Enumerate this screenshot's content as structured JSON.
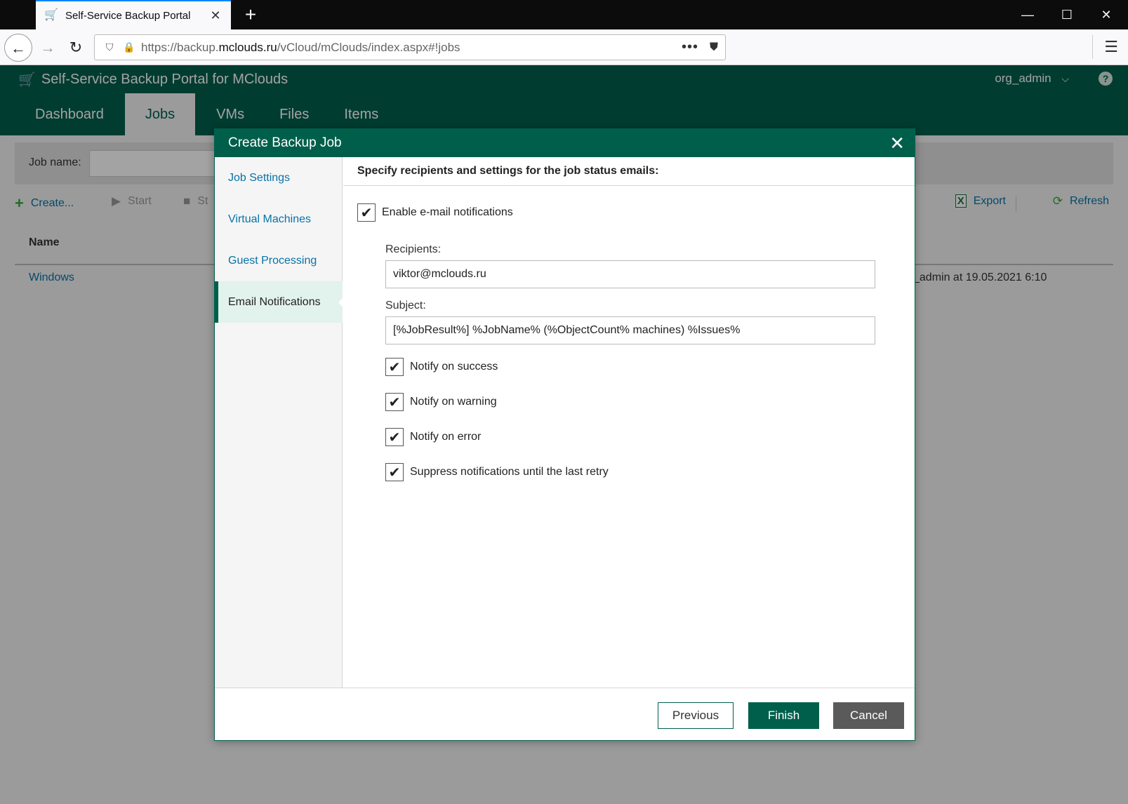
{
  "browser": {
    "tab_title": "Self-Service Backup Portal",
    "url_prefix": "https://backup.",
    "url_domain": "mclouds.ru",
    "url_path": "/vCloud/mClouds/index.aspx#!jobs"
  },
  "app": {
    "title": "Self-Service Backup Portal for MClouds",
    "user": "org_admin",
    "tabs": [
      "Dashboard",
      "Jobs",
      "VMs",
      "Files",
      "Items"
    ],
    "active_tab": "Jobs",
    "filter_label": "Job name:",
    "toolbar": {
      "create": "Create...",
      "start": "Start",
      "stop": "St",
      "export": "Export",
      "refresh": "Refresh"
    },
    "grid": {
      "col_name": "Name",
      "rows": [
        {
          "name": "Windows",
          "modified": "_admin at 19.05.2021 6:10"
        }
      ]
    }
  },
  "dialog": {
    "title": "Create Backup Job",
    "steps": [
      "Job Settings",
      "Virtual Machines",
      "Guest Processing",
      "Email Notifications"
    ],
    "active_step": "Email Notifications",
    "heading": "Specify recipients and settings for the job status emails:",
    "enable_label": "Enable e-mail notifications",
    "recipients_label": "Recipients:",
    "recipients_value": "viktor@mclouds.ru",
    "subject_label": "Subject:",
    "subject_value": "[%JobResult%] %JobName% (%ObjectCount% machines) %Issues%",
    "options": [
      {
        "label": "Notify on success",
        "checked": true
      },
      {
        "label": "Notify on warning",
        "checked": true
      },
      {
        "label": "Notify on error",
        "checked": true
      },
      {
        "label": "Suppress notifications until the last retry",
        "checked": true
      }
    ],
    "buttons": {
      "previous": "Previous",
      "finish": "Finish",
      "cancel": "Cancel"
    }
  },
  "colors": {
    "brand": "#005f4b",
    "link": "#0673a8"
  }
}
